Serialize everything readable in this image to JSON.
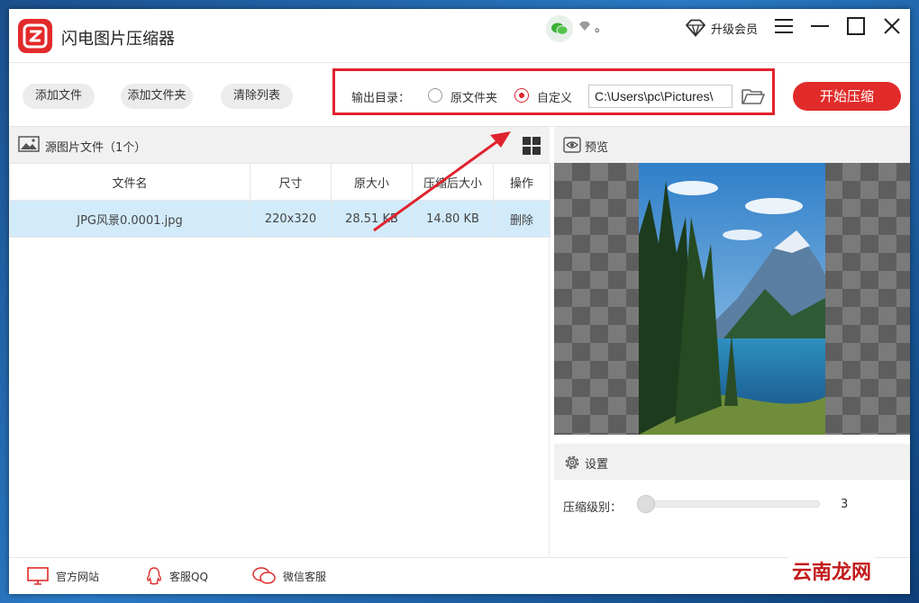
{
  "app": {
    "title": "闪电图片压缩器",
    "dot": "。",
    "upgrade_label": "升级会员"
  },
  "toolbar": {
    "add_file": "添加文件",
    "add_folder": "添加文件夹",
    "clear_list": "清除列表",
    "output_label": "输出目录：",
    "radio_original": "原文件夹",
    "radio_custom": "自定义",
    "selected_option": "自定义",
    "output_path": "C:\\Users\\pc\\Pictures\\",
    "start_button": "开始压缩"
  },
  "source": {
    "title": "源图片文件（1个）",
    "columns": [
      "文件名",
      "尺寸",
      "原大小",
      "压缩后大小",
      "操作"
    ],
    "rows": [
      {
        "name": "JPG风景0.0001.jpg",
        "dimensions": "220x320",
        "original_size": "28.51 KB",
        "compressed_size": "14.80 KB",
        "action": "删除"
      }
    ]
  },
  "preview": {
    "title": "预览"
  },
  "settings": {
    "title": "设置",
    "level_label": "压缩级别：",
    "level_value": "3"
  },
  "footer": {
    "website": "官方网站",
    "qq": "客服QQ",
    "wechat": "微信客服"
  },
  "watermark": "云南龙网",
  "colors": {
    "accent": "#e12b2b",
    "selected_row": "#d2ebfb",
    "annotation": "#e0232e"
  }
}
